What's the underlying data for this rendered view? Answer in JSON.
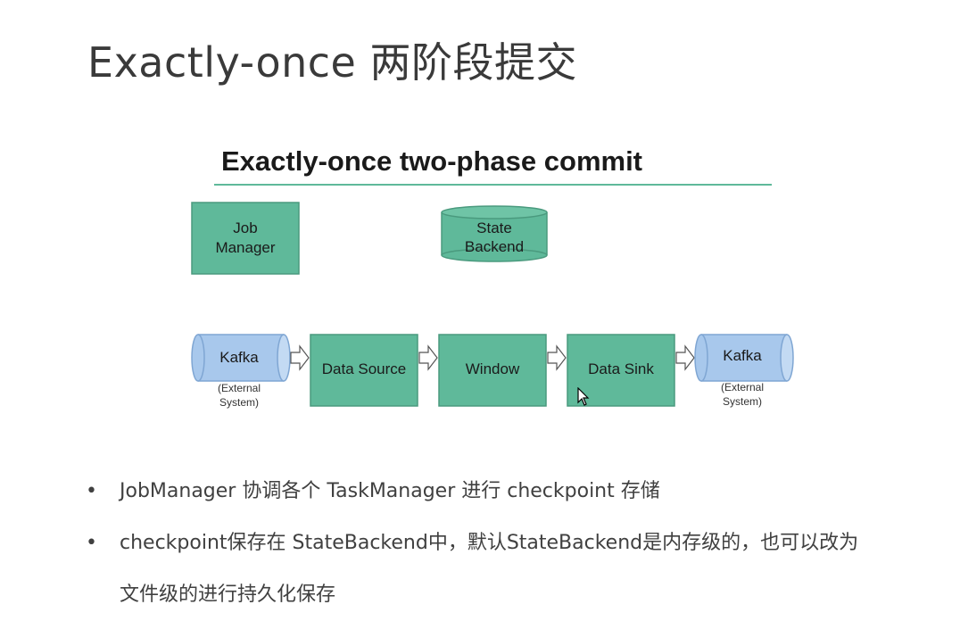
{
  "slide": {
    "title": "Exactly-once 两阶段提交"
  },
  "diagram": {
    "heading": "Exactly-once two-phase commit",
    "job_manager": [
      "Job",
      "Manager"
    ],
    "state_backend": [
      "State",
      "Backend"
    ],
    "source_kafka": {
      "label": "Kafka",
      "caption": [
        "(External",
        "System)"
      ]
    },
    "pipeline": [
      "Data Source",
      "Window",
      "Data Sink"
    ],
    "sink_kafka": {
      "label": "Kafka",
      "caption": [
        "(External",
        "System)"
      ]
    },
    "colors": {
      "green_fill": "#5fb99a",
      "green_stroke": "#4a9a7e",
      "blue_fill": "#a8c8ec",
      "blue_stroke": "#7fa6d3",
      "rule": "#5fb99a"
    }
  },
  "bullets": [
    {
      "text": "JobManager 协调各个 TaskManager 进行 checkpoint 存储"
    },
    {
      "text": "checkpoint保存在 StateBackend中，默认StateBackend是内存级的，也可以改为",
      "continuation": "文件级的进行持久化保存"
    }
  ],
  "icons": {
    "bullet": "•",
    "cursor": "mouse-pointer-icon"
  }
}
